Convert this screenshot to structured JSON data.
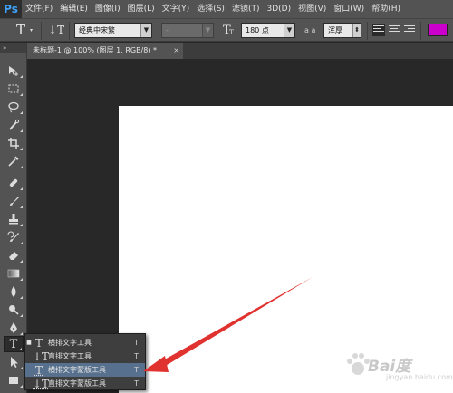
{
  "app": {
    "logo": "Ps"
  },
  "menu": [
    "文件(F)",
    "编辑(E)",
    "图像(I)",
    "图层(L)",
    "文字(Y)",
    "选择(S)",
    "滤镜(T)",
    "3D(D)",
    "视图(V)",
    "窗口(W)",
    "帮助(H)"
  ],
  "options": {
    "tool_glyph": "T",
    "orientation_glyph": "↓T",
    "font_family": "经典中宋繁",
    "font_style": "-",
    "font_size": "180 点",
    "aa_label": "a a",
    "aa_method": "浑厚",
    "text_color": "#cc00cc"
  },
  "document": {
    "tab_title": "未标题-1 @ 100% (图层 1, RGB/8) *",
    "close_label": "×"
  },
  "toolbar": {
    "header": "»"
  },
  "flyout": {
    "items": [
      {
        "label": "横排文字工具",
        "key": "T",
        "selected": true
      },
      {
        "label": "直排文字工具",
        "key": "T",
        "selected": false
      },
      {
        "label": "横排文字蒙版工具",
        "key": "T",
        "selected": false,
        "highlighted": true
      },
      {
        "label": "直排文字蒙版工具",
        "key": "T",
        "selected": false
      }
    ],
    "bullet": "■"
  },
  "watermark": {
    "text": "Bai度",
    "sub": "jingyan.baidu.com"
  },
  "colors": {
    "arrow": "#e0322f",
    "canvas": "#ffffff",
    "highlight": "#56708d"
  }
}
